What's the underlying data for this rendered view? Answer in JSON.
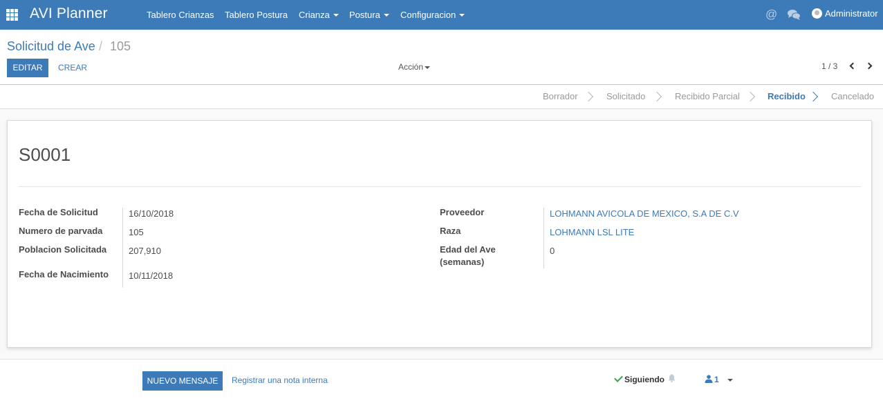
{
  "app": {
    "title": "AVI Planner"
  },
  "topnav": {
    "items": [
      {
        "label": "Tablero Crianzas",
        "dropdown": false
      },
      {
        "label": "Tablero Postura",
        "dropdown": false
      },
      {
        "label": "Crianza",
        "dropdown": true
      },
      {
        "label": "Postura",
        "dropdown": true
      },
      {
        "label": "Configuracion",
        "dropdown": true
      }
    ],
    "user": "Administrator",
    "icons": [
      "apps-grid-icon",
      "at-sign-icon",
      "chat-bubbles-icon",
      "user-avatar"
    ]
  },
  "breadcrumb": {
    "parent": "Solicitud de Ave",
    "separator": "/",
    "current": "105"
  },
  "toolbar": {
    "edit_label": "EDITAR",
    "create_label": "CREAR",
    "action_label": "Acción"
  },
  "pager": {
    "text": "1 / 3"
  },
  "statusbar": {
    "stages": [
      "Borrador",
      "Solicitado",
      "Recibido Parcial",
      "Recibido",
      "Cancelado"
    ],
    "active": "Recibido"
  },
  "record": {
    "name": "S0001",
    "left_fields": [
      {
        "label": "Fecha de Solicitud",
        "value": "16/10/2018"
      },
      {
        "label": "Numero de parvada",
        "value": "105"
      },
      {
        "label": "Poblacion Solicitada",
        "value": "207,910"
      },
      {
        "label": "Fecha de Nacimiento",
        "value": "10/11/2018"
      }
    ],
    "right_fields": [
      {
        "label": "Proveedor",
        "value": "LOHMANN AVICOLA DE MEXICO, S.A DE C.V",
        "link": true
      },
      {
        "label": "Raza",
        "value": "LOHMANN LSL LITE",
        "link": true
      },
      {
        "label": "Edad del Ave (semanas)",
        "label_lines": [
          "Edad del Ave",
          "(semanas)"
        ],
        "value": "0",
        "link": false
      }
    ]
  },
  "chatter": {
    "new_message_label": "NUEVO MENSAJE",
    "log_note_label": "Registrar una nota interna",
    "following_label": "Siguiendo",
    "followers_count": "1"
  },
  "colors": {
    "primary": "#3c7ab8",
    "navbar": "#3c7ab8",
    "success": "#3aa64c"
  }
}
